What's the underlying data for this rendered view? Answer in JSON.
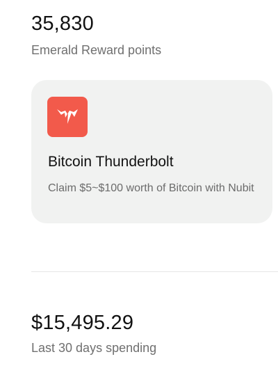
{
  "rewards": {
    "points_value": "35,830",
    "points_label": "Emerald Reward points"
  },
  "offer": {
    "logo_icon": "thunderbolt-logo-icon",
    "logo_color": "#f25a4b",
    "title": "Bitcoin Thunderbolt",
    "description": "Claim $5~$100 worth of Bitcoin with Nubit"
  },
  "spending": {
    "amount": "$15,495.29",
    "label": "Last 30 days spending"
  }
}
